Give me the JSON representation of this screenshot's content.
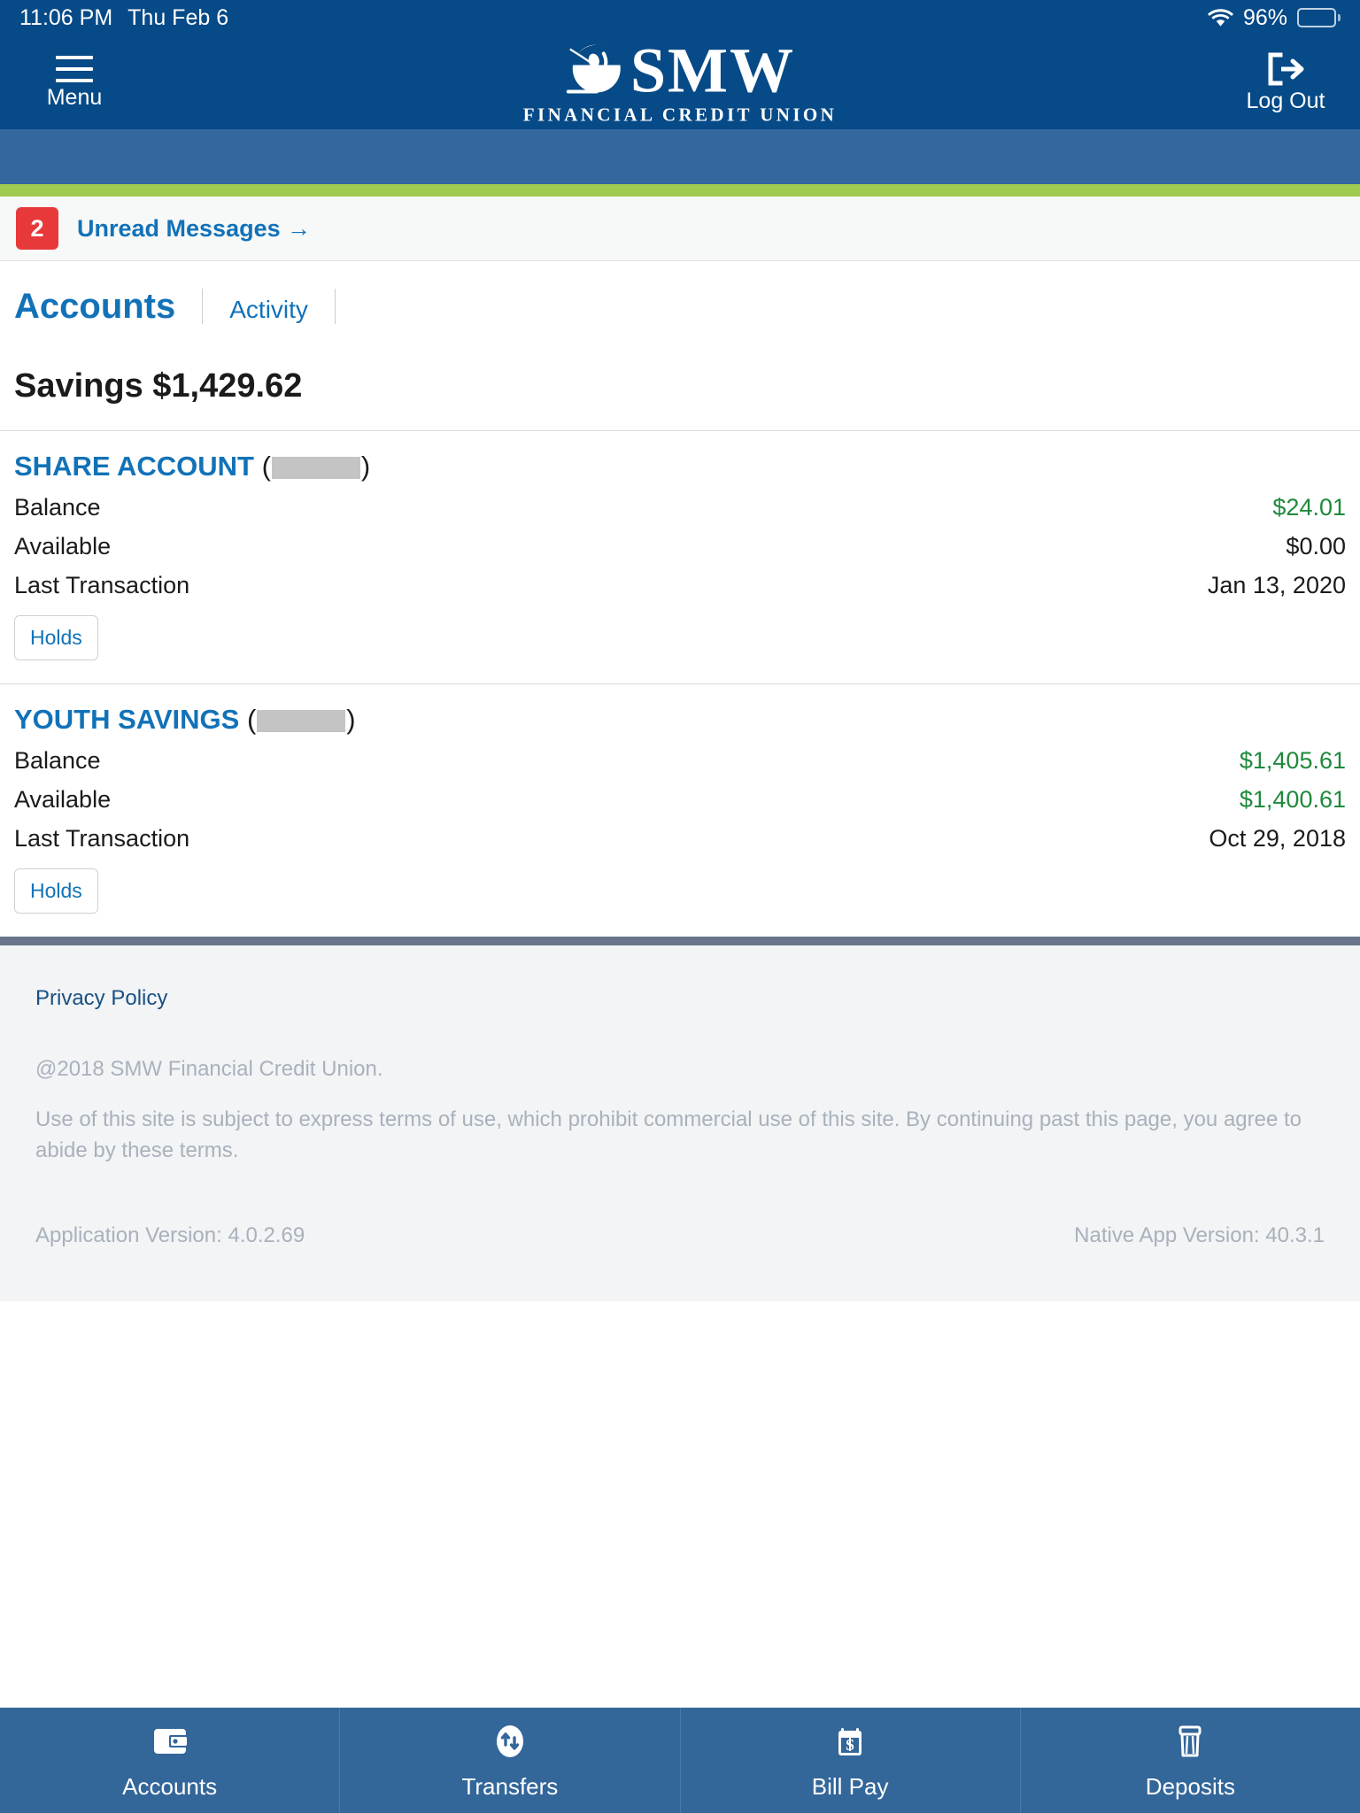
{
  "statusbar": {
    "time": "11:06 PM",
    "date": "Thu Feb 6",
    "battery_percent": "96%",
    "wifi_icon": "wifi-icon",
    "battery_icon": "battery-icon"
  },
  "header": {
    "menu_label": "Menu",
    "menu_icon": "hamburger-menu-icon",
    "logout_label": "Log Out",
    "logout_icon": "logout-arrow-icon",
    "logo_text": "SMW",
    "logo_subtitle": "FINANCIAL CREDIT UNION",
    "logo_icon": "smw-globe-logo-icon",
    "bg_color": "#064a87",
    "subbar_color": "#33679d",
    "accent_green": "#9fcb50"
  },
  "messages": {
    "count": "2",
    "label": "Unread Messages →",
    "badge_color": "#e8393a",
    "link_color": "#1272b8"
  },
  "tabs": {
    "active": "Accounts",
    "items": [
      "Accounts",
      "Activity"
    ]
  },
  "summary": {
    "label": "Savings $1,429.62",
    "group_name": "Savings",
    "group_total": "$1,429.62"
  },
  "accounts": [
    {
      "name": "SHARE ACCOUNT",
      "number_masked": "",
      "rows": [
        {
          "label": "Balance",
          "value": "$24.01",
          "positive": true
        },
        {
          "label": "Available",
          "value": "$0.00",
          "positive": false
        },
        {
          "label": "Last Transaction",
          "value": "Jan 13, 2020",
          "positive": false
        }
      ],
      "holds_label": "Holds"
    },
    {
      "name": "YOUTH SAVINGS",
      "number_masked": "",
      "rows": [
        {
          "label": "Balance",
          "value": "$1,405.61",
          "positive": true
        },
        {
          "label": "Available",
          "value": "$1,400.61",
          "positive": true
        },
        {
          "label": "Last Transaction",
          "value": "Oct 29, 2018",
          "positive": false
        }
      ],
      "holds_label": "Holds"
    }
  ],
  "footer": {
    "privacy_policy": "Privacy Policy",
    "copyright": "@2018 SMW Financial Credit Union.",
    "terms": "Use of this site is subject to express terms of use, which prohibit commercial use of this site. By continuing past this page, you agree to abide by these terms.",
    "application_version": "Application Version: 4.0.2.69",
    "native_app_version": "Native App Version: 40.3.1"
  },
  "bottomnav": {
    "bg_color": "#336699",
    "items": [
      {
        "label": "Accounts",
        "icon": "wallet-icon"
      },
      {
        "label": "Transfers",
        "icon": "transfer-arrows-icon"
      },
      {
        "label": "Bill Pay",
        "icon": "calendar-dollar-icon"
      },
      {
        "label": "Deposits",
        "icon": "check-deposit-icon"
      }
    ]
  }
}
